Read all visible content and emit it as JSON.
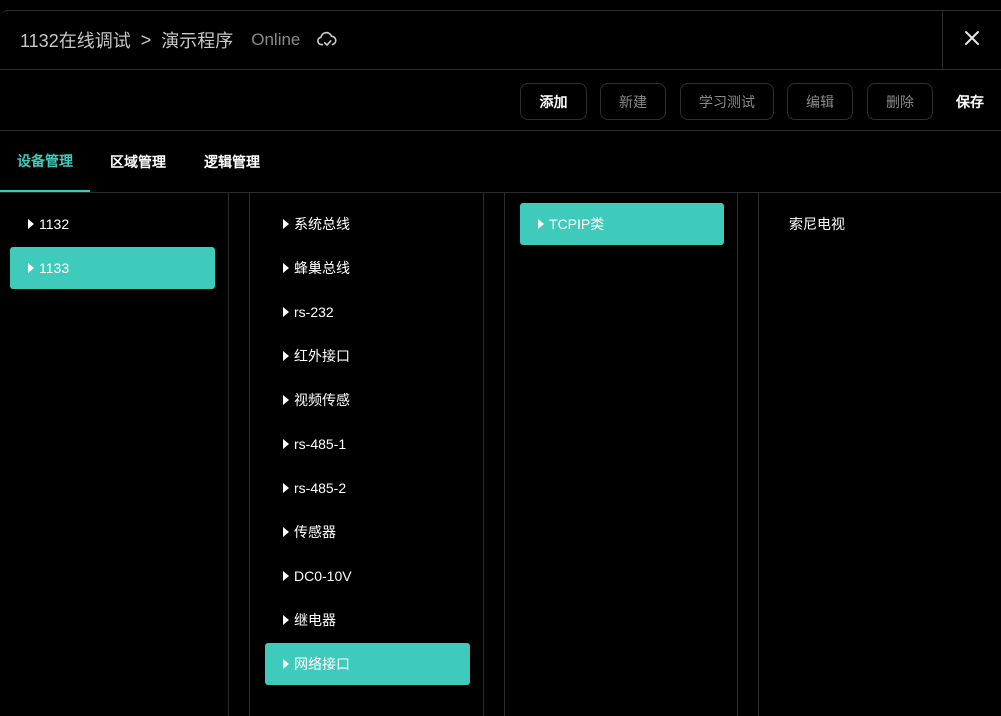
{
  "header": {
    "crumb_root": "1132在线调试",
    "crumb_sep": ">",
    "crumb_current": "演示程序",
    "status": "Online",
    "cloud_icon": "cloud-sync-icon",
    "close_icon": "close-icon"
  },
  "toolbar": {
    "add": "添加",
    "new": "新建",
    "learn_test": "学习测试",
    "edit": "编辑",
    "delete": "删除",
    "save": "保存"
  },
  "tabs": [
    "设备管理",
    "区域管理",
    "逻辑管理"
  ],
  "active_tab": 0,
  "hosts": [
    "1132",
    "1133"
  ],
  "selected_host": "1133",
  "interfaces": [
    "系统总线",
    "蜂巢总线",
    "rs-232",
    "红外接口",
    "视频传感",
    "rs-485-1",
    "rs-485-2",
    "传感器",
    "DC0-10V",
    "继电器",
    "网络接口"
  ],
  "selected_interface": "网络接口",
  "categories": [
    "TCPIP类"
  ],
  "selected_category": "TCPIP类",
  "devices": [
    "索尼电视"
  ],
  "colors": {
    "accent": "#3ecbbc",
    "background": "#000000",
    "border": "#2c2c2c"
  }
}
